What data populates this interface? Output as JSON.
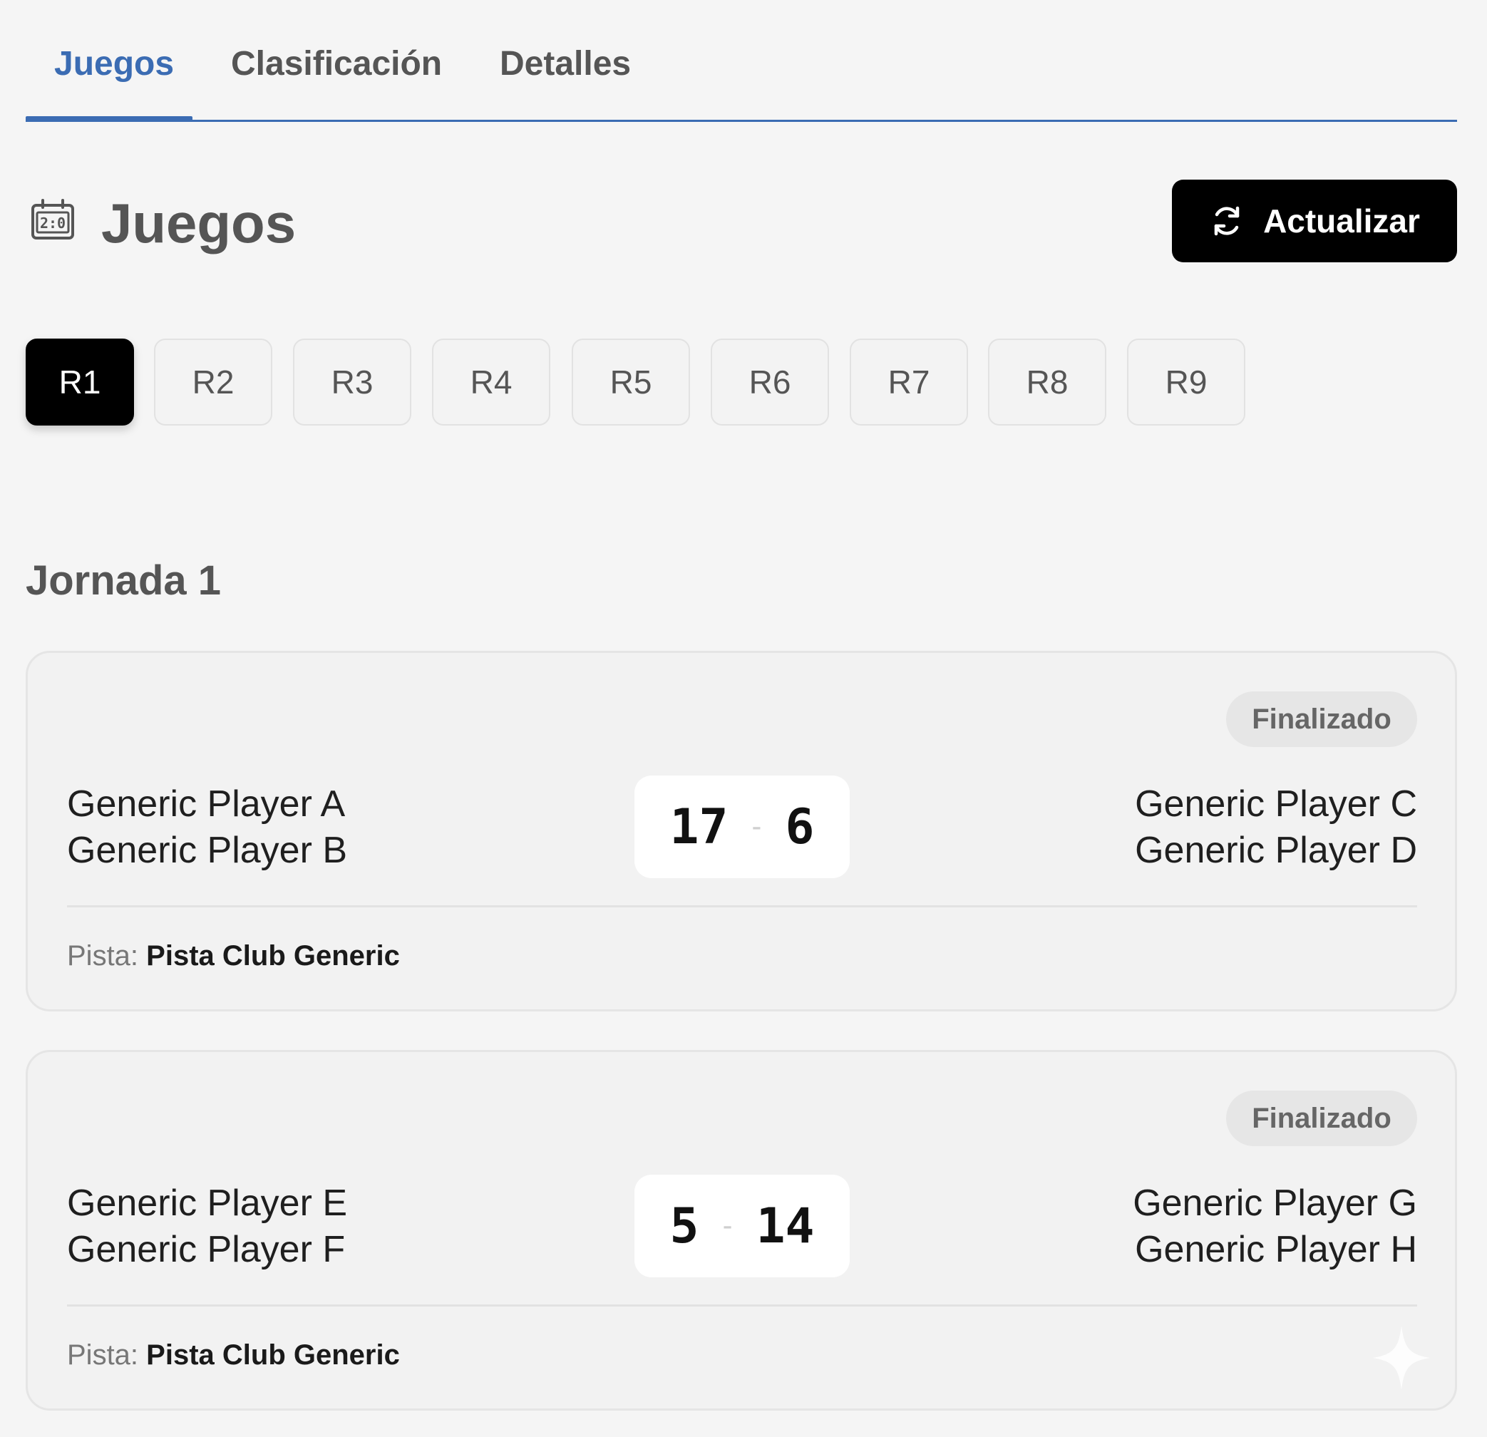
{
  "tabs": [
    {
      "label": "Juegos",
      "active": true
    },
    {
      "label": "Clasificación",
      "active": false
    },
    {
      "label": "Detalles",
      "active": false
    }
  ],
  "header": {
    "title": "Juegos",
    "icon": "scoreboard-icon",
    "refresh_label": "Actualizar",
    "refresh_icon": "refresh-icon"
  },
  "rounds": [
    "R1",
    "R2",
    "R3",
    "R4",
    "R5",
    "R6",
    "R7",
    "R8",
    "R9"
  ],
  "selected_round": "R1",
  "jornada": {
    "title": "Jornada 1"
  },
  "court_label": "Pista:",
  "matches": [
    {
      "status": "Finalizado",
      "team_left": [
        "Generic Player A",
        "Generic Player B"
      ],
      "team_right": [
        "Generic Player C",
        "Generic Player D"
      ],
      "score_left": "17",
      "score_sep": "-",
      "score_right": "6",
      "court": "Pista Club Generic"
    },
    {
      "status": "Finalizado",
      "team_left": [
        "Generic Player E",
        "Generic Player F"
      ],
      "team_right": [
        "Generic Player G",
        "Generic Player H"
      ],
      "score_left": "5",
      "score_sep": "-",
      "score_right": "14",
      "court": "Pista Club Generic"
    }
  ],
  "colors": {
    "accent": "#3b6cb3",
    "button_bg": "#000000",
    "background": "#f5f5f5",
    "badge_bg": "#e6e6e6"
  }
}
